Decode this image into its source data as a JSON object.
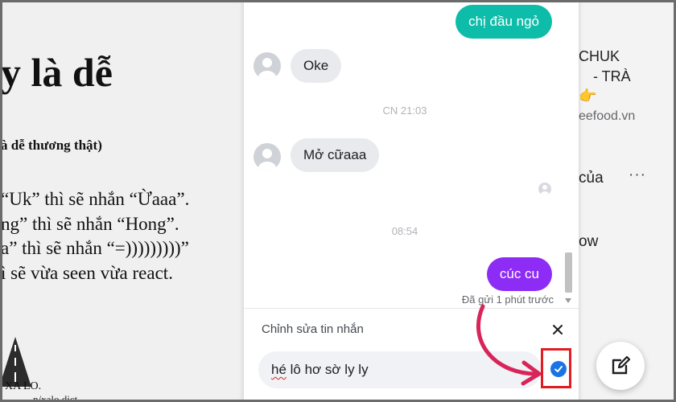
{
  "document": {
    "title": "y là dễ",
    "subtitle": "à dễ thương thật)",
    "lines": [
      "“Uk” thì sẽ nhắn “Ừaaa”.",
      "ng” thì sẽ nhắn “Hong”.",
      "a” thì sẽ nhắn “=)))))))))”",
      "ì sẽ vừa seen vừa react."
    ],
    "logo_text": "XA LO.",
    "logo_url": "n/xalo.dict"
  },
  "right_panel": {
    "line1": "CHUK",
    "line2": "- TRÀ",
    "emoji": "👉",
    "domain": "eefood.vn",
    "line4": "của",
    "more": "···",
    "line5": "ow"
  },
  "chat": {
    "messages": [
      {
        "type": "out",
        "text": "chị đầu ngỏ"
      },
      {
        "type": "in",
        "text": "Oke"
      },
      {
        "type": "time",
        "text": "CN 21:03"
      },
      {
        "type": "in",
        "text": "Mở cữaaa"
      },
      {
        "type": "time",
        "text": "08:54"
      },
      {
        "type": "out",
        "text": "cúc cu"
      }
    ],
    "sent_status": "Đã gửi 1 phút trước",
    "edit": {
      "title": "Chỉnh sửa tin nhắn",
      "input_value_underlined": "hé",
      "input_value_rest": " lô hơ sờ ly ly"
    }
  },
  "colors": {
    "outgoing_teal": "#0dbca9",
    "outgoing_purple": "#8d2cf5",
    "confirm_blue": "#1b74e4",
    "highlight_red": "#e11d23"
  },
  "icons": [
    "avatar-icon",
    "close-icon",
    "check-icon",
    "compose-icon",
    "arrow-annotation"
  ]
}
